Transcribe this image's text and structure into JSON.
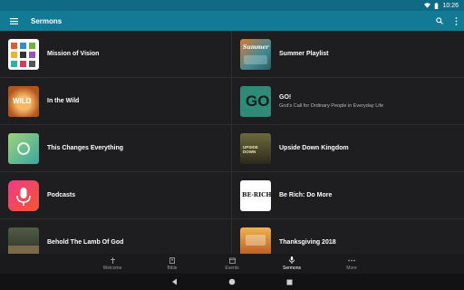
{
  "status": {
    "time": "10:26"
  },
  "appbar": {
    "title": "Sermons"
  },
  "sermons": [
    {
      "title": "Mission of Vision",
      "subtitle": ""
    },
    {
      "title": "Summer Playlist",
      "subtitle": ""
    },
    {
      "title": "In the Wild",
      "subtitle": ""
    },
    {
      "title": "GO!",
      "subtitle": "God's Call for Ordinary People in Everyday Life"
    },
    {
      "title": "This Changes Everything",
      "subtitle": ""
    },
    {
      "title": "Upside Down Kingdom",
      "subtitle": ""
    },
    {
      "title": "Podcasts",
      "subtitle": ""
    },
    {
      "title": "Be Rich: Do More",
      "subtitle": ""
    },
    {
      "title": "Behold The Lamb Of God",
      "subtitle": ""
    },
    {
      "title": "Thanksgiving 2018",
      "subtitle": ""
    }
  ],
  "thumb_text": {
    "go": "GO",
    "berich": "BE·RICH",
    "wild": "WILD",
    "summer": "Summer",
    "upside": "UPSIDE DOWN"
  },
  "nav": [
    {
      "label": "Welcome",
      "icon": "cross-icon"
    },
    {
      "label": "Bible",
      "icon": "book-icon"
    },
    {
      "label": "Events",
      "icon": "calendar-icon"
    },
    {
      "label": "Sermons",
      "icon": "microphone-icon"
    },
    {
      "label": "More",
      "icon": "more-dots-icon"
    }
  ],
  "colors": {
    "appbar": "#137a96",
    "statusbar": "#0f6b85",
    "background": "#1e1e20"
  }
}
